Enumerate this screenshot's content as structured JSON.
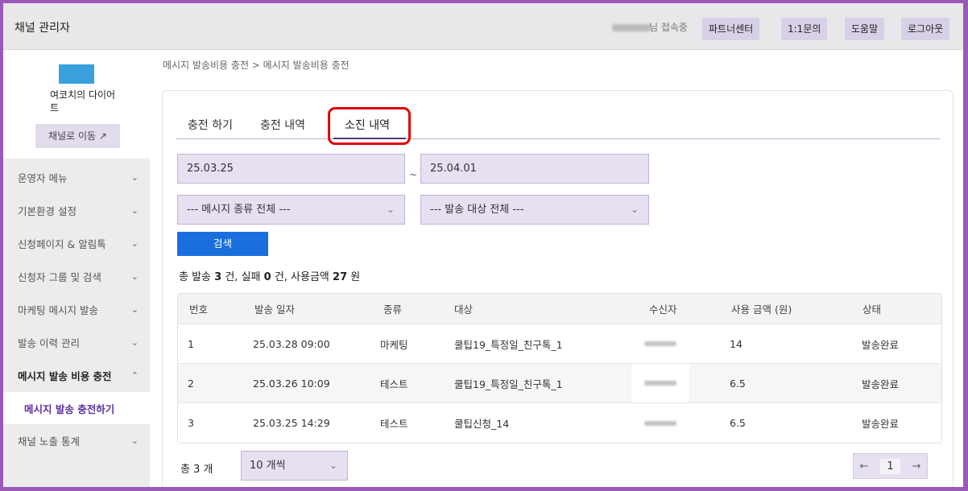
{
  "app": {
    "title": "채널 관리자"
  },
  "header": {
    "user_status": "님 접속중",
    "buttons": [
      "파트너센터",
      "1:1문의",
      "도움말",
      "로그아웃"
    ]
  },
  "sidebar": {
    "channel_name": "여코치의 다이어트",
    "channel_move": "채널로 이동 ↗",
    "thumb_color": "#3aa0dc",
    "items": [
      {
        "label": "운영자 메뉴",
        "chevron": "⌄"
      },
      {
        "label": "기본환경 설정",
        "chevron": "⌄"
      },
      {
        "label": "신청페이지 & 알림톡",
        "chevron": "⌄"
      },
      {
        "label": "신청자 그룹 및 검색",
        "chevron": "⌄"
      },
      {
        "label": "마케팅 메시지 발송",
        "chevron": "⌄"
      },
      {
        "label": "발송 이력 관리",
        "chevron": "⌄"
      },
      {
        "label": "메시지 발송 비용 충전",
        "chevron": "⌃"
      },
      {
        "label": "메시지 발송 충전하기"
      },
      {
        "label": "채널 노출 통계",
        "chevron": "⌄"
      }
    ]
  },
  "breadcrumb": "메시지 발송비용 충전 > 메시지 발송비용 충전",
  "tabs": [
    {
      "label": "충전 하기"
    },
    {
      "label": "충전 내역"
    },
    {
      "label": "소진 내역"
    }
  ],
  "filters": {
    "date_from": "25.03.25",
    "date_sep": "~",
    "date_to": "25.04.01",
    "message_type": "--- 메시지 종류 전체 ---",
    "target": "--- 발송 대상 전체 ---",
    "search_label": "검색"
  },
  "summary": {
    "prefix": "총 발송",
    "sent": "3",
    "sent_unit": "건, 실패",
    "failed": "0",
    "failed_unit": "건, 사용금액",
    "amount": "27",
    "amount_unit": "원"
  },
  "table": {
    "headers": [
      "번호",
      "발송 일자",
      "종류",
      "대상",
      "수신자",
      "사용 금액 (원)",
      "상태"
    ],
    "rows": [
      {
        "no": "1",
        "date": "25.03.28 09:00",
        "type": "마케팅",
        "target": "쿨팁19_특정일_친구톡_1",
        "amount": "14",
        "status": "발송완료"
      },
      {
        "no": "2",
        "date": "25.03.26 10:09",
        "type": "테스트",
        "target": "쿨팁19_특정일_친구톡_1",
        "amount": "6.5",
        "status": "발송완료"
      },
      {
        "no": "3",
        "date": "25.03.25 14:29",
        "type": "테스트",
        "target": "쿨팁신청_14",
        "amount": "6.5",
        "status": "발송완료"
      }
    ]
  },
  "footer": {
    "total": "총 3 개",
    "page_size": "10 개씩",
    "page": "1",
    "prev": "←",
    "next": "→"
  },
  "icons": {
    "select_chevron": "⌄"
  }
}
